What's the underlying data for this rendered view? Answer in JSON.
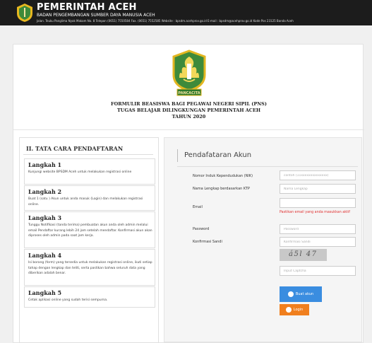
{
  "header": {
    "title": "PEMERINTAH ACEH",
    "subtitle": "BADAN PENGEMBANGAN SUMBER DAYA MANUSIA ACEH",
    "address": "Jalan. Teuku Panglima Nyak Makam No. 8 Telepon (0651) 7550584 Fax. (0651) 7552585 Website : bpsdm.acehprov.go.id E-mail : bpsdm@acehprov.go.id Kode Pos 23125 Banda Aceh",
    "logo_icon": "aceh-crest-icon"
  },
  "form_header": {
    "crest_banner": "PANCACITA",
    "line1": "FORMULIR BEASISWA BAGI PEGAWAI NEGERI SIPIL (PNS)",
    "line2": "TUGAS BELAJAR DILINGKUNGAN PEMERINTAH ACEH",
    "line3": "TAHUN 2020"
  },
  "steps": {
    "heading": "II. TATA CARA PENDAFTARAN",
    "items": [
      {
        "title": "Langkah 1",
        "text": "Kunjungi website BPSDM Aceh untuk melakukan registrasi online"
      },
      {
        "title": "Langkah 2",
        "text": "Buat 1 (satu ) Akun untuk anda masuk (Login) dan melakukan registrasi online."
      },
      {
        "title": "Langkah 3",
        "text": "Tunggu Notifikasi (tanda terima) pembuatan akun anda oleh admin melalui email Pendaftar kurang lebih 24 jam setelah mendaftar. Konfirmasi akun akan diproses oleh admin pada saat jam kerja."
      },
      {
        "title": "Langkah 4",
        "text": "Isi borang (form) yang tersedia untuk melakukan registrasi online, ikuti setiap tahap dengan lengkap dan teliti, serta pastikan bahwa seluruh data yang diberikan adalah benar."
      },
      {
        "title": "Langkah 5",
        "text": "Cetak aplikasi online yang sudah terisi sempurna."
      }
    ]
  },
  "registration": {
    "title": "Pendafataran Akun",
    "nik_label": "Nomor Induk Kependudukan (NIK)",
    "nik_placeholder": "contoh (11xxxxxxxxxxxxxx)",
    "name_label": "Nama Lengkap berdasarkan KTP",
    "name_placeholder": "Nama Lengkap",
    "email_label": "Email",
    "email_value": "",
    "email_warning": "Pastikan email yang anda masukkan aktif",
    "password_label": "Password",
    "password_placeholder": "Password",
    "confirm_label": "Konfirmasi Sandi",
    "confirm_placeholder": "Konfirmasi Sandi",
    "captcha_text": "á5l 47",
    "captcha_placeholder": "Input Captcha",
    "create_button": "Buat akun",
    "login_button": "Login",
    "colors": {
      "primary": "#3a8de0",
      "login": "#f07f1e",
      "warning": "#e03030"
    }
  }
}
